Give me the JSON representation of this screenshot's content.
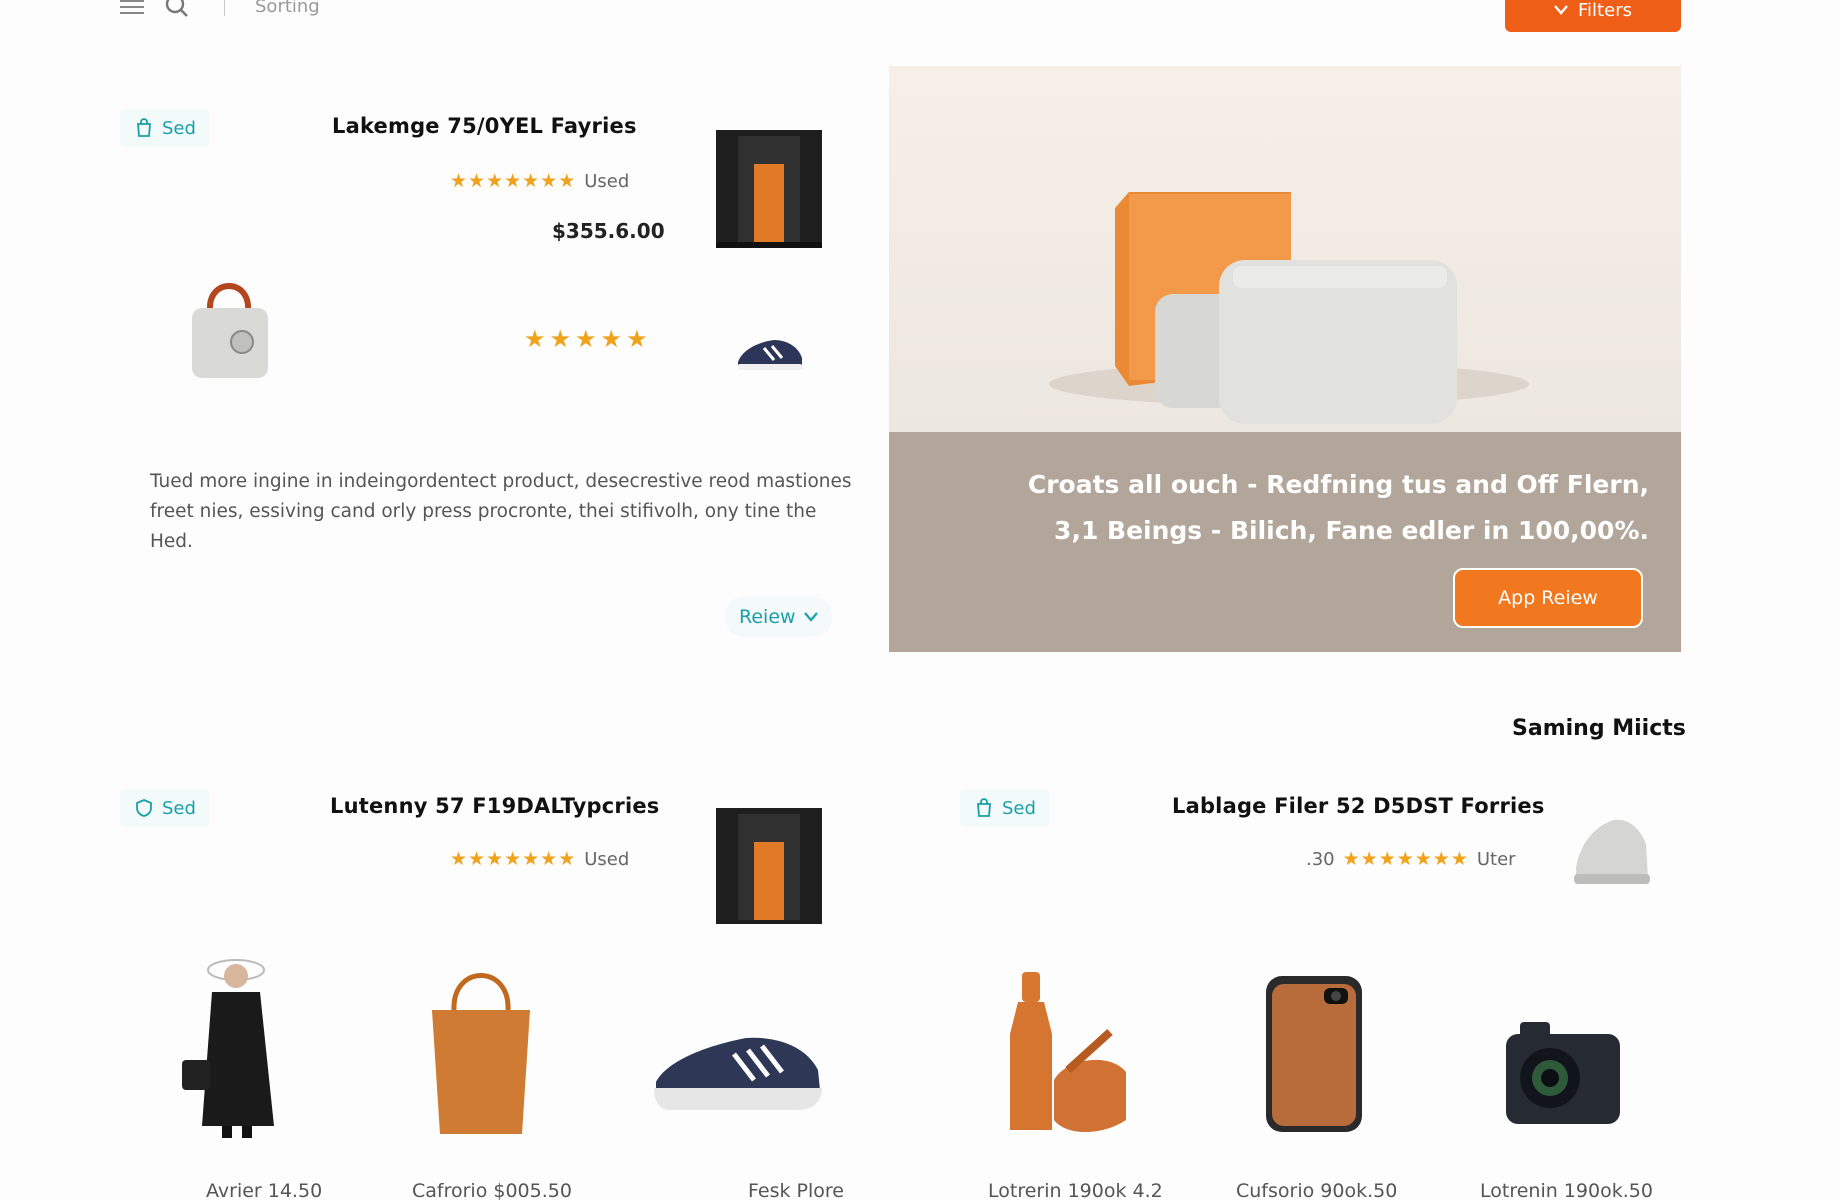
{
  "topbar": {
    "search_placeholder": "Sorting",
    "filters_label": "Filters"
  },
  "featured": {
    "name": "Lakemge 75/0YEL Fayries",
    "rating_label": "Used",
    "stars": "★★★★★★★",
    "price": "$355.6.00",
    "save_label": "Sed",
    "secondary_stars": "★★★★★",
    "description": "Tued more ingine in indeingordentect product, desecrestive reod mastiones freet nies, essiving cand orly press procronte, thei stifivolh, ony tine the Hed.",
    "review_label": "Reiew"
  },
  "hero": {
    "caption": "Croats all ouch - Redfning tus and Off Flern, 3,1 Beings - Bilich, Fane edler in 100,00%.",
    "cta_label": "App Reiew"
  },
  "section": {
    "title": "Saming Miicts"
  },
  "products": [
    {
      "name": "Lutenny 57 F19DALTypcries",
      "rating_label": "Used",
      "stars": "★★★★★★★",
      "save_label": "Sed"
    },
    {
      "name": "Lablage Filer 52 D5DST Forries",
      "rating_label": "Uter",
      "stars": "★★★★★★★",
      "extra": ".30",
      "save_label": "Sed"
    }
  ],
  "grid": [
    {
      "caption": "Avrier 14.50"
    },
    {
      "caption": "Cafrorio $005.50"
    },
    {
      "caption": "Fesk Plore"
    },
    {
      "caption": "Lotrerin 190ok 4.2"
    },
    {
      "caption": "Cufsorio 90ok.50"
    },
    {
      "caption": "Lotrenin 190ok.50"
    }
  ]
}
